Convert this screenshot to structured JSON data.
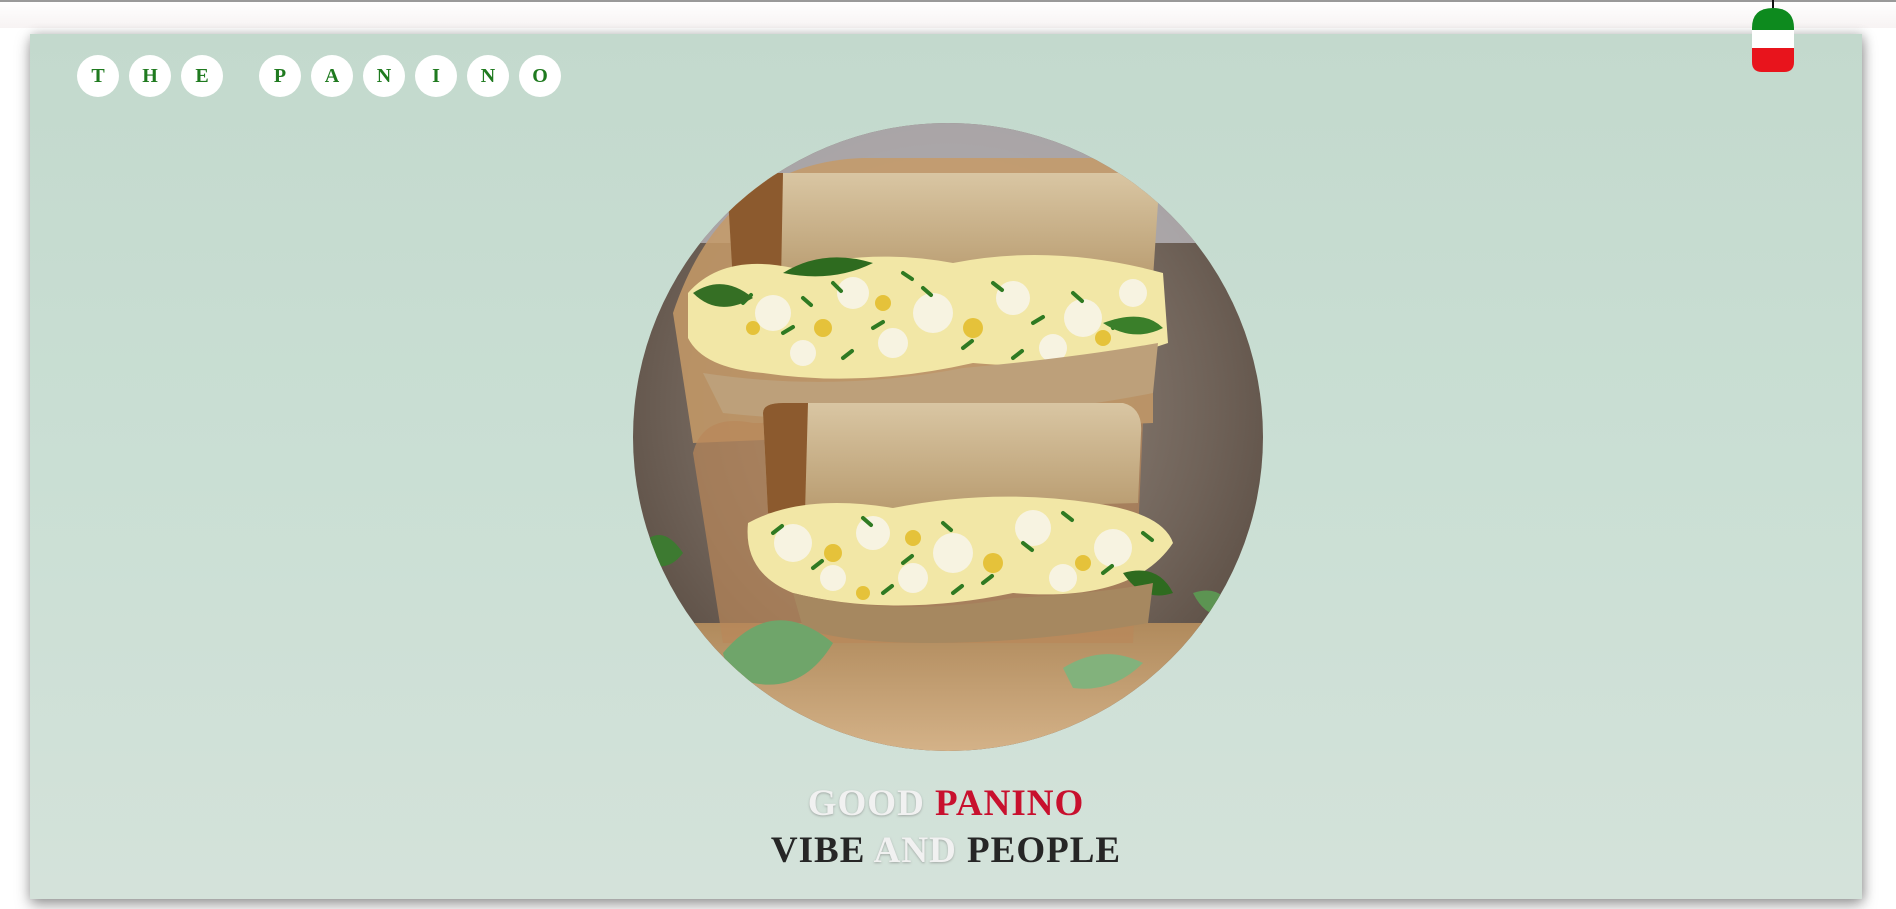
{
  "brand": {
    "logo_letters": [
      "T",
      "H",
      "E",
      "P",
      "A",
      "N",
      "I",
      "N",
      "O"
    ]
  },
  "hero": {
    "image_alt": "egg salad sandwich with chives"
  },
  "headline": {
    "line1": {
      "word1": "GOOD",
      "word2": "PANINO"
    },
    "line2": {
      "word1": "VIBE",
      "word2": "AND",
      "word3": "PEOPLE"
    }
  },
  "flag_toggle": {
    "icon": "italian-flag-icon",
    "colors": [
      "#0d8a1e",
      "#ffffff",
      "#e8141c"
    ]
  },
  "colors": {
    "background": "#c8dccf",
    "logo_text": "#1f7a1f",
    "accent_red": "#c8102e",
    "dark_text": "#262626"
  }
}
